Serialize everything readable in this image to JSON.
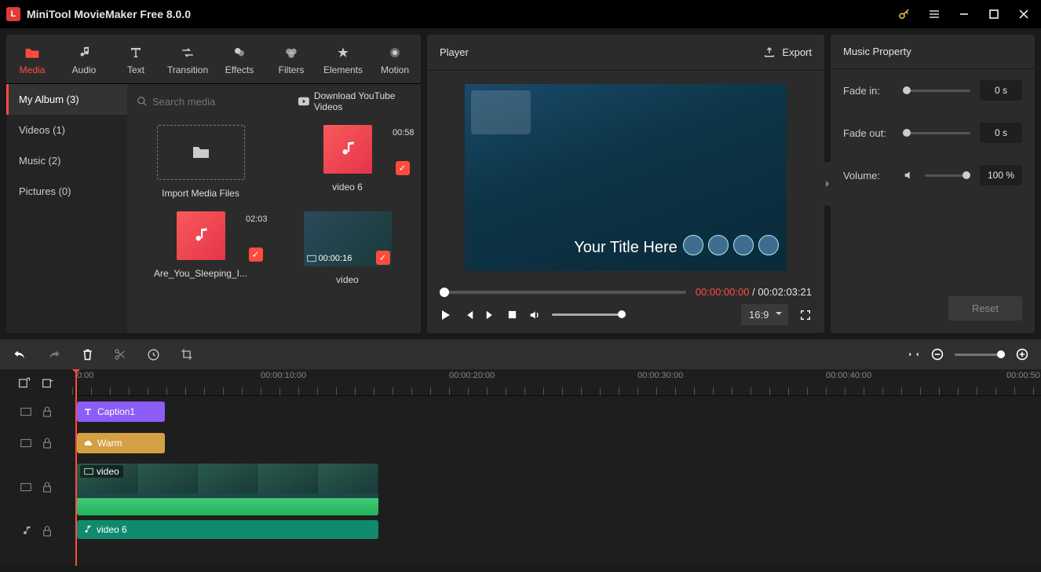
{
  "app": {
    "title": "MiniTool MovieMaker Free 8.0.0"
  },
  "tabs": [
    "Media",
    "Audio",
    "Text",
    "Transition",
    "Effects",
    "Filters",
    "Elements",
    "Motion"
  ],
  "sidebar": {
    "items": [
      {
        "label": "My Album (3)"
      },
      {
        "label": "Videos (1)"
      },
      {
        "label": "Music (2)"
      },
      {
        "label": "Pictures (0)"
      }
    ]
  },
  "search": {
    "placeholder": "Search media"
  },
  "yt_link": "Download YouTube Videos",
  "media": {
    "import_label": "Import Media Files",
    "items": [
      {
        "label": "video 6",
        "dur": "00:58"
      },
      {
        "label": "Are_You_Sleeping_I...",
        "dur": "02:03"
      },
      {
        "label": "video",
        "dur": "00:00:16"
      }
    ]
  },
  "player": {
    "title": "Player",
    "export": "Export",
    "overlay": "Your Title Here",
    "time_current": "00:00:00:00",
    "time_total": "00:02:03:21",
    "aspect": "16:9"
  },
  "props": {
    "title": "Music Property",
    "fade_in_label": "Fade in:",
    "fade_in_value": "0 s",
    "fade_out_label": "Fade out:",
    "fade_out_value": "0 s",
    "volume_label": "Volume:",
    "volume_value": "100 %",
    "reset": "Reset"
  },
  "ruler": [
    "0:00",
    "00:00:10:00",
    "00:00:20:00",
    "00:00:30:00",
    "00:00:40:00",
    "00:00:50"
  ],
  "clips": {
    "caption": "Caption1",
    "warm": "Warm",
    "video": "video",
    "audio": "video 6"
  }
}
